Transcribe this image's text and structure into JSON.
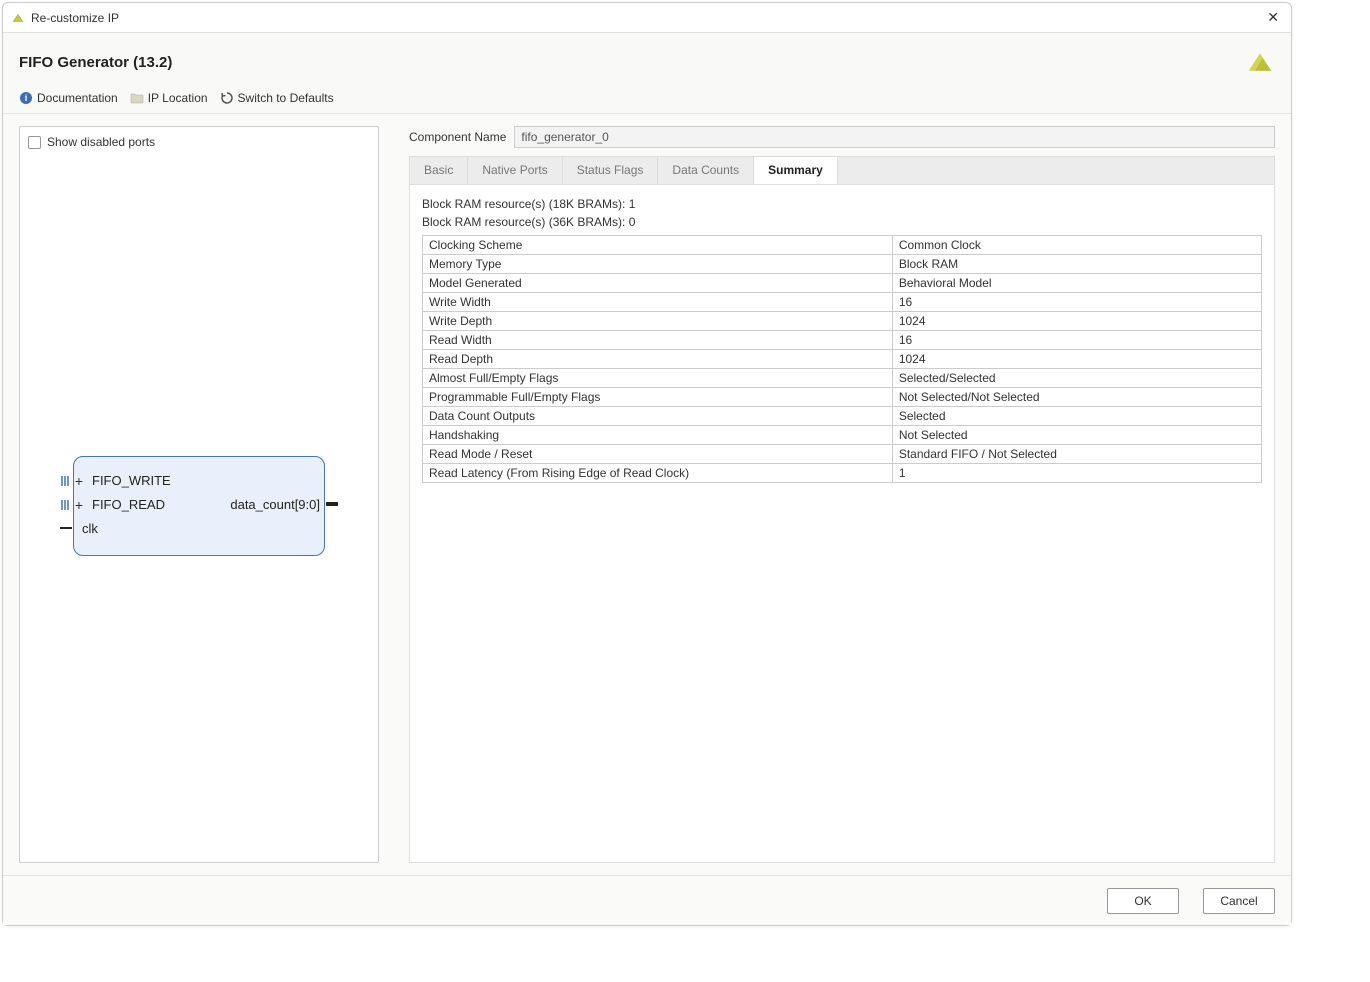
{
  "window": {
    "title": "Re-customize IP"
  },
  "header": {
    "title": "FIFO Generator (13.2)",
    "doc_label": "Documentation",
    "iploc_label": "IP Location",
    "defaults_label": "Switch to Defaults"
  },
  "left": {
    "show_disabled_label": "Show disabled ports",
    "ports": {
      "write": "FIFO_WRITE",
      "read": "FIFO_READ",
      "clk": "clk",
      "data_count": "data_count[9:0]"
    }
  },
  "right": {
    "component_name_label": "Component Name",
    "component_name_value": "fifo_generator_0",
    "tabs": [
      "Basic",
      "Native Ports",
      "Status Flags",
      "Data Counts",
      "Summary"
    ],
    "active_tab": "Summary",
    "info_lines": [
      "Block RAM resource(s) (18K BRAMs): 1",
      "Block RAM resource(s) (36K BRAMs): 0"
    ],
    "summary_rows": [
      {
        "k": "Clocking Scheme",
        "v": "Common Clock"
      },
      {
        "k": "Memory Type",
        "v": "Block RAM"
      },
      {
        "k": "Model Generated",
        "v": "Behavioral Model"
      },
      {
        "k": "Write Width",
        "v": "16"
      },
      {
        "k": "Write Depth",
        "v": "1024"
      },
      {
        "k": "Read Width",
        "v": "16"
      },
      {
        "k": "Read Depth",
        "v": "1024"
      },
      {
        "k": "Almost Full/Empty Flags",
        "v": "Selected/Selected"
      },
      {
        "k": "Programmable Full/Empty Flags",
        "v": "Not Selected/Not Selected"
      },
      {
        "k": "Data Count Outputs",
        "v": "Selected"
      },
      {
        "k": "Handshaking",
        "v": "Not Selected"
      },
      {
        "k": "Read Mode / Reset",
        "v": "Standard FIFO / Not Selected"
      },
      {
        "k": "Read Latency (From Rising Edge of Read Clock)",
        "v": "1"
      }
    ]
  },
  "footer": {
    "ok_label": "OK",
    "cancel_label": "Cancel"
  }
}
